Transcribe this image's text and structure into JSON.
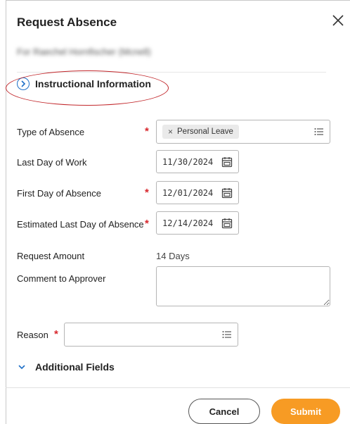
{
  "dialog": {
    "title": "Request Absence",
    "subtitle": "For Raechel Hornfischer (Mcnell)"
  },
  "instructional": {
    "label": "Instructional Information"
  },
  "form": {
    "type_of_absence": {
      "label": "Type of Absence",
      "value": "Personal Leave"
    },
    "last_day_of_work": {
      "label": "Last Day of Work",
      "value": "11/30/2024"
    },
    "first_day_of_absence": {
      "label": "First Day of Absence",
      "value": "12/01/2024"
    },
    "estimated_last_day": {
      "label": "Estimated Last Day of Absence",
      "value": "12/14/2024"
    },
    "request_amount": {
      "label": "Request Amount",
      "value": "14 Days"
    },
    "comment": {
      "label": "Comment to Approver",
      "value": ""
    },
    "reason": {
      "label": "Reason",
      "value": ""
    },
    "required_mark": "*"
  },
  "additional_fields": {
    "label": "Additional Fields"
  },
  "buttons": {
    "cancel": "Cancel",
    "submit": "Submit"
  },
  "colors": {
    "accent": "#1e6fc7",
    "required": "#d8272d",
    "submit": "#f79b24",
    "annotation": "#c2282c"
  }
}
